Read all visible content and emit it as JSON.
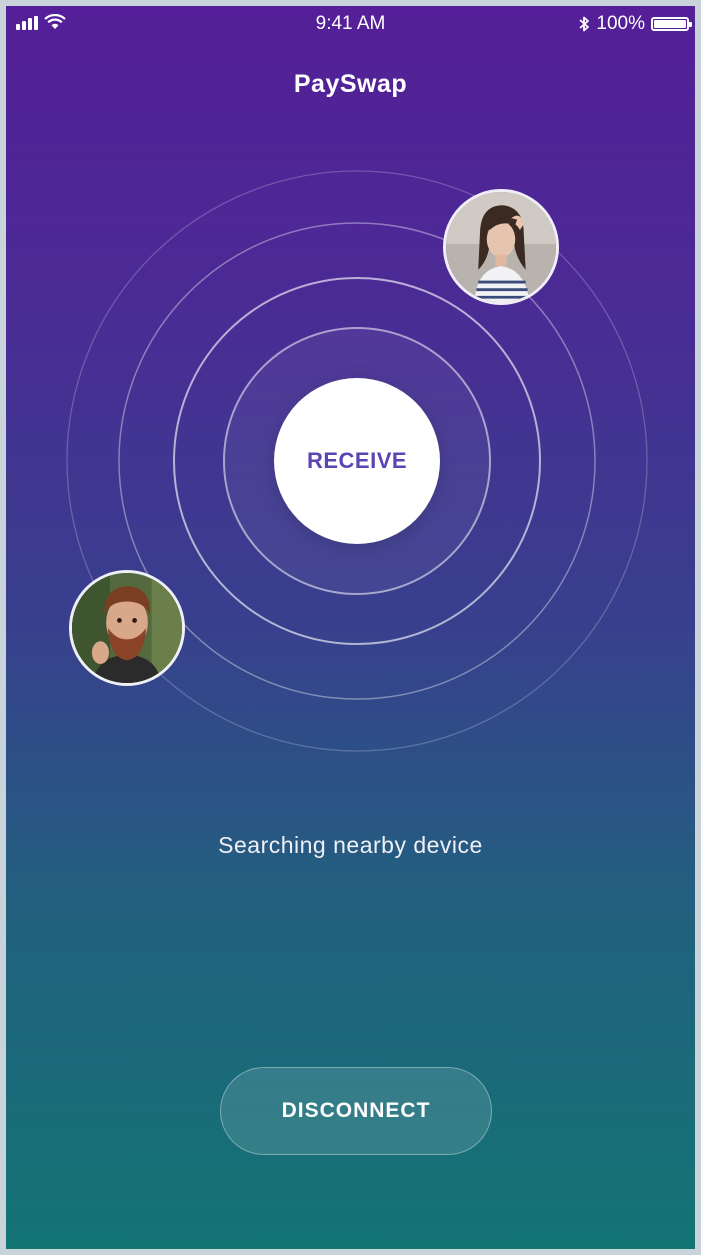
{
  "status_bar": {
    "time": "9:41 AM",
    "battery": "100%",
    "signal_icon": "signal-bars-icon",
    "wifi_icon": "wifi-icon",
    "bluetooth_icon": "bluetooth-icon",
    "battery_icon": "battery-icon"
  },
  "header": {
    "title": "PaySwap"
  },
  "radar": {
    "center_label": "RECEIVE",
    "nearby_users": [
      {
        "avatar": "woman-avatar"
      },
      {
        "avatar": "man-avatar"
      }
    ]
  },
  "status": {
    "text": "Searching nearby device"
  },
  "actions": {
    "disconnect_label": "DISCONNECT"
  },
  "colors": {
    "gradient_top": "#541f98",
    "gradient_bottom": "#137474",
    "accent": "#5b44b4"
  }
}
